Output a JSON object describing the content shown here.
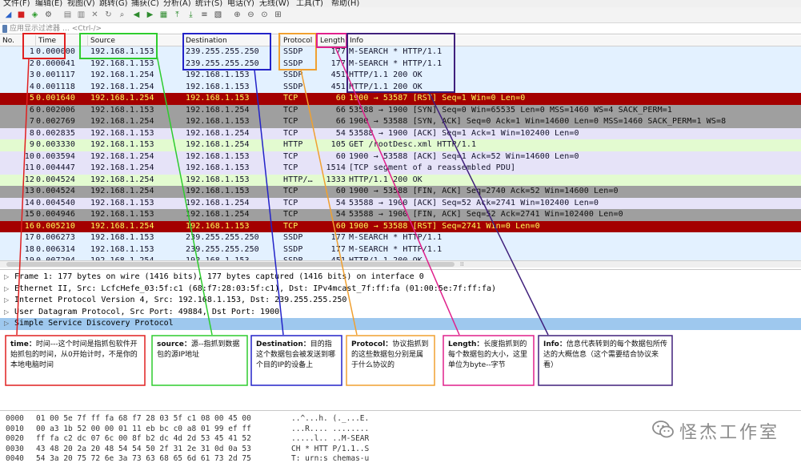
{
  "menu": {
    "items": [
      "文件(F)",
      "编辑(E)",
      "视图(V)",
      "跳转(G)",
      "捕获(C)",
      "分析(A)",
      "统计(S)",
      "电话(Y)",
      "无线(W)",
      "工具(T)",
      "帮助(H)"
    ]
  },
  "toolbar": {
    "buttons": [
      "shark-fin-icon",
      "stop-icon",
      "restart-icon",
      "options-icon",
      "open-icon",
      "save-icon",
      "close-file-icon",
      "reload-icon",
      "find-icon",
      "back-icon",
      "forward-icon",
      "goto-icon",
      "first-icon",
      "last-icon",
      "autoscroll-icon",
      "colorize-icon",
      "zoom-in-icon",
      "zoom-out-icon",
      "zoom-reset-icon",
      "resize-columns-icon"
    ]
  },
  "filter": {
    "placeholder": "应用显示过滤器 … <Ctrl-/>"
  },
  "columns": {
    "no": "No.",
    "time": "Time",
    "source": "Source",
    "destination": "Destination",
    "protocol": "Protocol",
    "length": "Length",
    "info": "Info"
  },
  "colors": {
    "ssdp": "#e3f1ff",
    "tcp": "#e6e3f8",
    "http": "#e3fbd0",
    "rst": "#a40000",
    "syn": "#9f9f9f",
    "rst_text": "#ffff5a",
    "selected_detail": "#9ec8ee"
  },
  "packets": [
    {
      "no": "1",
      "time": "0.000000",
      "src": "192.168.1.153",
      "dst": "239.255.255.250",
      "proto": "SSDP",
      "len": "177",
      "info": "M-SEARCH * HTTP/1.1",
      "style": "ssdp"
    },
    {
      "no": "2",
      "time": "0.000041",
      "src": "192.168.1.153",
      "dst": "239.255.255.250",
      "proto": "SSDP",
      "len": "177",
      "info": "M-SEARCH * HTTP/1.1",
      "style": "ssdp"
    },
    {
      "no": "3",
      "time": "0.001117",
      "src": "192.168.1.254",
      "dst": "192.168.1.153",
      "proto": "SSDP",
      "len": "451",
      "info": "HTTP/1.1 200 OK",
      "style": "ssdp"
    },
    {
      "no": "4",
      "time": "0.001118",
      "src": "192.168.1.254",
      "dst": "192.168.1.153",
      "proto": "SSDP",
      "len": "451",
      "info": "HTTP/1.1 200 OK",
      "style": "ssdp"
    },
    {
      "no": "5",
      "time": "0.001640",
      "src": "192.168.1.254",
      "dst": "192.168.1.153",
      "proto": "TCP",
      "len": "60",
      "info": "1900 → 53587 [RST] Seq=1 Win=0 Len=0",
      "style": "rst"
    },
    {
      "no": "6",
      "time": "0.002006",
      "src": "192.168.1.153",
      "dst": "192.168.1.254",
      "proto": "TCP",
      "len": "66",
      "info": "53588 → 1900 [SYN] Seq=0 Win=65535 Len=0 MSS=1460 WS=4 SACK_PERM=1",
      "style": "syn"
    },
    {
      "no": "7",
      "time": "0.002769",
      "src": "192.168.1.254",
      "dst": "192.168.1.153",
      "proto": "TCP",
      "len": "66",
      "info": "1900 → 53588 [SYN, ACK] Seq=0 Ack=1 Win=14600 Len=0 MSS=1460 SACK_PERM=1 WS=8",
      "style": "syn"
    },
    {
      "no": "8",
      "time": "0.002835",
      "src": "192.168.1.153",
      "dst": "192.168.1.254",
      "proto": "TCP",
      "len": "54",
      "info": "53588 → 1900 [ACK] Seq=1 Ack=1 Win=102400 Len=0",
      "style": "tcp"
    },
    {
      "no": "9",
      "time": "0.003330",
      "src": "192.168.1.153",
      "dst": "192.168.1.254",
      "proto": "HTTP",
      "len": "105",
      "info": "GET /rootDesc.xml HTTP/1.1",
      "style": "http"
    },
    {
      "no": "10",
      "time": "0.003594",
      "src": "192.168.1.254",
      "dst": "192.168.1.153",
      "proto": "TCP",
      "len": "60",
      "info": "1900 → 53588 [ACK] Seq=1 Ack=52 Win=14600 Len=0",
      "style": "tcp"
    },
    {
      "no": "11",
      "time": "0.004447",
      "src": "192.168.1.254",
      "dst": "192.168.1.153",
      "proto": "TCP",
      "len": "1514",
      "info": "[TCP segment of a reassembled PDU]",
      "style": "tcp"
    },
    {
      "no": "12",
      "time": "0.004524",
      "src": "192.168.1.254",
      "dst": "192.168.1.153",
      "proto": "HTTP/…",
      "len": "1333",
      "info": "HTTP/1.1 200 OK",
      "style": "http"
    },
    {
      "no": "13",
      "time": "0.004524",
      "src": "192.168.1.254",
      "dst": "192.168.1.153",
      "proto": "TCP",
      "len": "60",
      "info": "1900 → 53588 [FIN, ACK] Seq=2740 Ack=52 Win=14600 Len=0",
      "style": "syn"
    },
    {
      "no": "14",
      "time": "0.004540",
      "src": "192.168.1.153",
      "dst": "192.168.1.254",
      "proto": "TCP",
      "len": "54",
      "info": "53588 → 1900 [ACK] Seq=52 Ack=2741 Win=102400 Len=0",
      "style": "tcp"
    },
    {
      "no": "15",
      "time": "0.004946",
      "src": "192.168.1.153",
      "dst": "192.168.1.254",
      "proto": "TCP",
      "len": "54",
      "info": "53588 → 1900 [FIN, ACK] Seq=52 Ack=2741 Win=102400 Len=0",
      "style": "syn"
    },
    {
      "no": "16",
      "time": "0.005210",
      "src": "192.168.1.254",
      "dst": "192.168.1.153",
      "proto": "TCP",
      "len": "60",
      "info": "1900 → 53588 [RST] Seq=2741 Win=0 Len=0",
      "style": "rst"
    },
    {
      "no": "17",
      "time": "0.006273",
      "src": "192.168.1.153",
      "dst": "239.255.255.250",
      "proto": "SSDP",
      "len": "177",
      "info": "M-SEARCH * HTTP/1.1",
      "style": "ssdp"
    },
    {
      "no": "18",
      "time": "0.006314",
      "src": "192.168.1.153",
      "dst": "239.255.255.250",
      "proto": "SSDP",
      "len": "177",
      "info": "M-SEARCH * HTTP/1.1",
      "style": "ssdp"
    },
    {
      "no": "19",
      "time": "0.007294",
      "src": "192.168.1.254",
      "dst": "192.168.1.153",
      "proto": "SSDP",
      "len": "451",
      "info": "HTTP/1.1 200 OK",
      "style": "ssdp"
    }
  ],
  "details": [
    {
      "text": "Frame 1: 177 bytes on wire (1416 bits), 177 bytes captured (1416 bits) on interface 0",
      "selected": false
    },
    {
      "text": "Ethernet II, Src: LcfcHefe_03:5f:c1 (68:f7:28:03:5f:c1), Dst: IPv4mcast_7f:ff:fa (01:00:5e:7f:ff:fa)",
      "selected": false
    },
    {
      "text": "Internet Protocol Version 4, Src: 192.168.1.153, Dst: 239.255.255.250",
      "selected": false
    },
    {
      "text": "User Datagram Protocol, Src Port: 49884, Dst Port: 1900",
      "selected": false
    },
    {
      "text": "Simple Service Discovery Protocol",
      "selected": true
    }
  ],
  "hex": [
    {
      "off": "0000",
      "hex": "01 00 5e 7f ff fa 68 f7  28 03 5f c1 08 00 45 00",
      "asc": "..^...h. (._...E."
    },
    {
      "off": "0010",
      "hex": "00 a3 1b 52 00 00 01 11  eb bc c0 a8 01 99 ef ff",
      "asc": "...R.... ........"
    },
    {
      "off": "0020",
      "hex": "ff fa c2 dc 07 6c 00 8f  b2 dc 4d 2d 53 45 41 52",
      "asc": ".....l.. ..M-SEAR"
    },
    {
      "off": "0030",
      "hex": "43 48 20 2a 20 48 54 54  50 2f 31 2e 31 0d 0a 53",
      "asc": "CH * HTT P/1.1..S"
    },
    {
      "off": "0040",
      "hex": "54 3a 20 75 72 6e 3a 73  63 68 65 6d 61 73 2d 75",
      "asc": "T: urn:s chemas-u"
    }
  ],
  "notes": [
    {
      "id": "time",
      "title": "time：",
      "body": "时间---这个时间是指抓包软件开始抓包的时间，从0开始计时，不是你的本地电脑时间",
      "color": "#e02020"
    },
    {
      "id": "source",
      "title": "source：",
      "body": "源--指抓到数据包的源IP地址",
      "color": "#2ecc2e"
    },
    {
      "id": "destination",
      "title": "Destination：",
      "body": "目的指这个数据包会被发送到哪个目的IP的设备上",
      "color": "#2323c8"
    },
    {
      "id": "protocol",
      "title": "Protocol：",
      "body": "协议指抓到的这些数据包分别是属于什么协议的",
      "color": "#f0a030"
    },
    {
      "id": "length",
      "title": "Length：",
      "body": "长度指抓到的每个数据包的大小，这里单位为byte--字节",
      "color": "#e0208c"
    },
    {
      "id": "info",
      "title": "Info：",
      "body": "信息代表转到的每个数据包所传达的大概信息（这个需要结合协议来看）",
      "color": "#40207c"
    }
  ],
  "watermark": {
    "text": "怪杰工作室",
    "color": "#8c8c8c"
  }
}
